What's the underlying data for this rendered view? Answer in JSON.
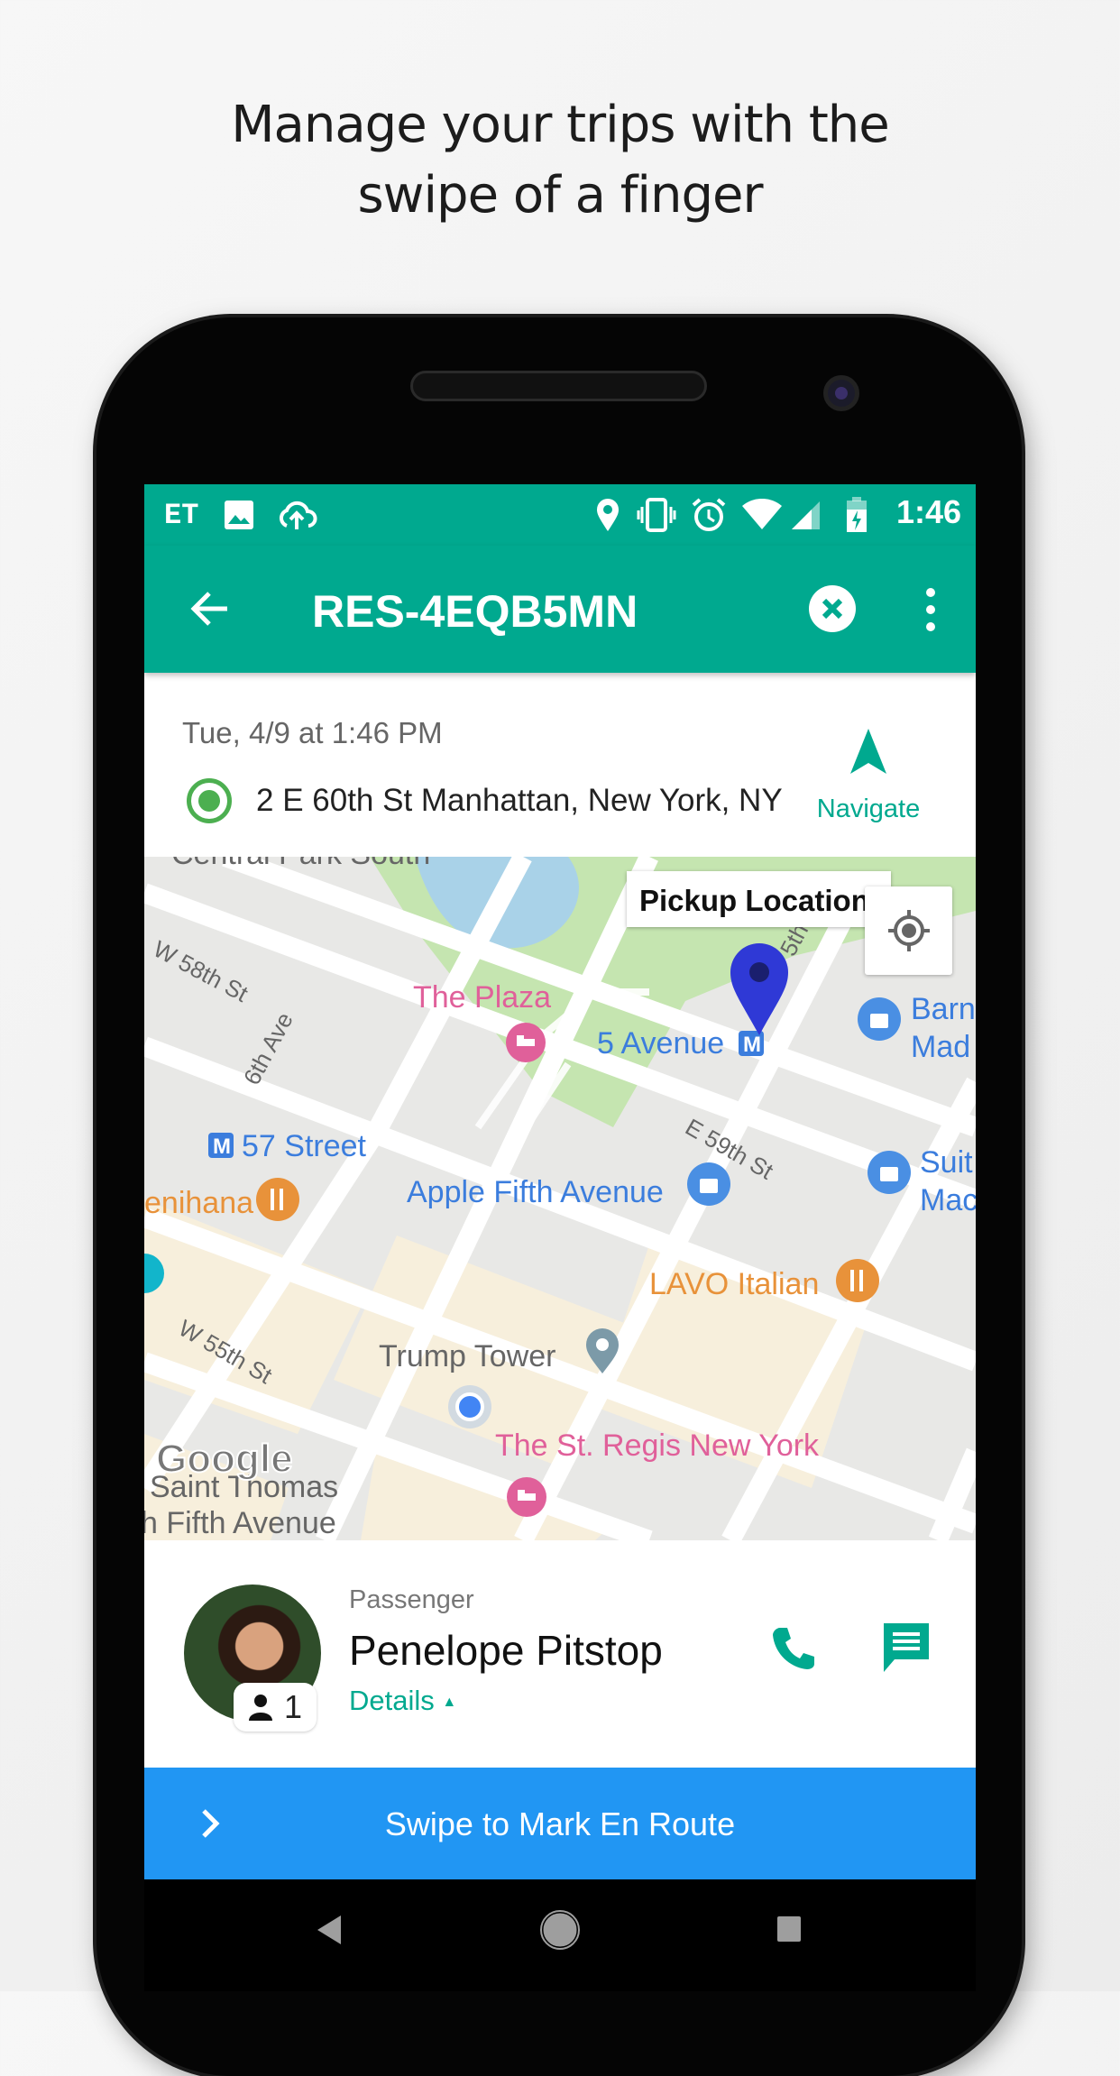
{
  "headline": {
    "line1": "Manage your trips with the",
    "line2": "swipe of a finger"
  },
  "status_bar": {
    "left_icons": [
      "et-app-icon",
      "image-icon",
      "cloud-upload-icon"
    ],
    "right_icons": [
      "location-icon",
      "vibrate-icon",
      "alarm-icon",
      "wifi-icon",
      "signal-icon",
      "battery-charging-icon"
    ],
    "carrier_label": "ET",
    "time": "1:46"
  },
  "app_bar": {
    "title": "RES-4EQB5MN",
    "back_icon": "arrow-back-icon",
    "cancel_icon": "close-circle-icon",
    "menu_icon": "more-vert-icon"
  },
  "trip": {
    "datetime": "Tue, 4/9 at 1:46 PM",
    "address": "2 E 60th St Manhattan, New York, NY",
    "navigate_label": "Navigate"
  },
  "map": {
    "tooltip": "Pickup Location",
    "labels": {
      "central_park_south": "Central Park South",
      "w58": "W 58th St",
      "plaza": "The Plaza",
      "five_ave": "5 Avenue",
      "barn1": "Barn",
      "barn2": "Mad",
      "sixth_ave": "6th Ave",
      "fifth": "5th",
      "street57": "57 Street",
      "e59": "E 59th St",
      "suit1": "Suit",
      "suit2": "Mac",
      "benihana": "enihana",
      "apple": "Apple Fifth Avenue",
      "lavo": "LAVO Italian",
      "w55": "W 55th St",
      "trump": "Trump Tower",
      "regis": "The St. Regis New York",
      "saint1": "Saint Thomas",
      "saint2": "h Fifth Avenue",
      "google": "Google",
      "metro": "M"
    },
    "colors": {
      "hotel": "#e0609a",
      "transit": "#3b7ddd",
      "food": "#e8923a",
      "pin": "#2f39d6"
    }
  },
  "passenger": {
    "label": "Passenger",
    "name": "Penelope Pitstop",
    "count": "1",
    "details_label": "Details"
  },
  "swipe": {
    "label": "Swipe to Mark En Route"
  },
  "colors": {
    "primary": "#00a98f",
    "swipe": "#2196f3",
    "ring": "#4caf50"
  }
}
